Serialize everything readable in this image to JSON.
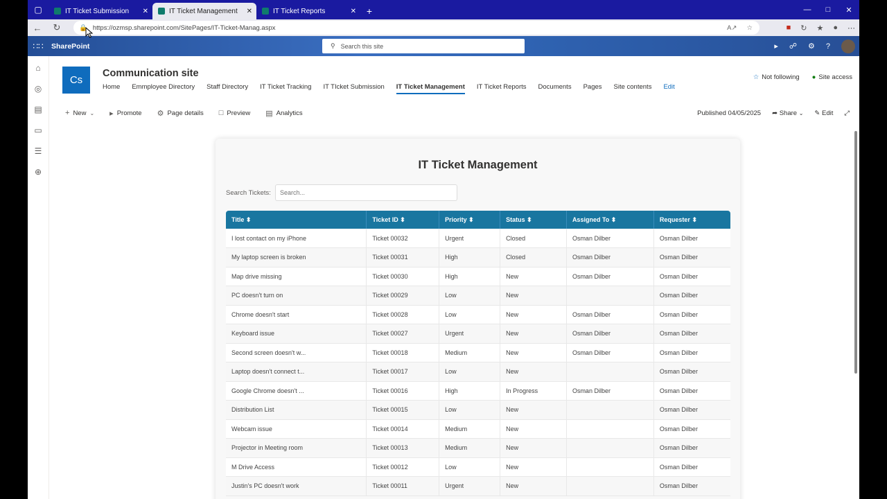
{
  "browser": {
    "tabs": [
      {
        "label": "IT Ticket Submission",
        "active": false
      },
      {
        "label": "IT Ticket Management",
        "active": true
      },
      {
        "label": "IT Ticket Reports",
        "active": false
      }
    ],
    "url": "https://ozmsp.sharepoint.com/SitePages/IT-Ticket-Manag.aspx"
  },
  "suitebar": {
    "brand": "SharePoint",
    "search_placeholder": "Search this site"
  },
  "site": {
    "logo": "Cs",
    "title": "Communication site",
    "nav": [
      "Home",
      "Emmployee Directory",
      "Staff Directory",
      "IT Ticket Tracking",
      "IT TIcket Submission",
      "IT Ticket Management",
      "IT Ticket Reports",
      "Documents",
      "Pages",
      "Site contents"
    ],
    "nav_active": "IT Ticket Management",
    "edit": "Edit",
    "not_following": "Not following",
    "site_access": "Site access"
  },
  "commandbar": {
    "new": "New",
    "promote": "Promote",
    "page_details": "Page details",
    "preview": "Preview",
    "analytics": "Analytics",
    "published": "Published 04/05/2025",
    "share": "Share",
    "edit": "Edit"
  },
  "main": {
    "title": "IT Ticket Management",
    "search_label": "Search Tickets:",
    "search_placeholder": "Search...",
    "columns": [
      "Title ⬍",
      "Ticket ID ⬍",
      "Priority ⬍",
      "Status ⬍",
      "Assigned To ⬍",
      "Requester ⬍"
    ],
    "rows": [
      [
        "I lost contact on my iPhone",
        "Ticket 00032",
        "Urgent",
        "Closed",
        "Osman Dilber",
        "Osman Dilber"
      ],
      [
        "My laptop screen is broken",
        "Ticket 00031",
        "High",
        "Closed",
        "Osman Dilber",
        "Osman Dilber"
      ],
      [
        "Map drive missing",
        "Ticket 00030",
        "High",
        "New",
        "Osman Dilber",
        "Osman Dilber"
      ],
      [
        "PC doesn't turn on",
        "Ticket 00029",
        "Low",
        "New",
        "",
        "Osman Dilber"
      ],
      [
        "Chrome doesn't start",
        "Ticket 00028",
        "Low",
        "New",
        "Osman Dilber",
        "Osman Dilber"
      ],
      [
        "Keyboard issue",
        "Ticket 00027",
        "Urgent",
        "New",
        "Osman Dilber",
        "Osman Dilber"
      ],
      [
        "Second screen doesn't w...",
        "Ticket 00018",
        "Medium",
        "New",
        "Osman Dilber",
        "Osman Dilber"
      ],
      [
        "Laptop doesn't connect t...",
        "Ticket 00017",
        "Low",
        "New",
        "",
        "Osman Dilber"
      ],
      [
        "Google Chrome doesn't ...",
        "Ticket 00016",
        "High",
        "In Progress",
        "Osman Dilber",
        "Osman Dilber"
      ],
      [
        "Distribution List",
        "Ticket 00015",
        "Low",
        "New",
        "",
        "Osman Dilber"
      ],
      [
        "Webcam issue",
        "Ticket 00014",
        "Medium",
        "New",
        "",
        "Osman Dilber"
      ],
      [
        "Projector in Meeting room",
        "Ticket 00013",
        "Medium",
        "New",
        "",
        "Osman Dilber"
      ],
      [
        "M Drive Access",
        "Ticket 00012",
        "Low",
        "New",
        "",
        "Osman Dilber"
      ],
      [
        "Justin's PC doesn't work",
        "Ticket 00011",
        "Urgent",
        "New",
        "",
        "Osman Dilber"
      ]
    ]
  },
  "colors": {
    "tabbar": "#1a1aa0",
    "suitebar": "#2a5aa8",
    "accent": "#0f6cbd",
    "table_header": "#1976a0"
  }
}
